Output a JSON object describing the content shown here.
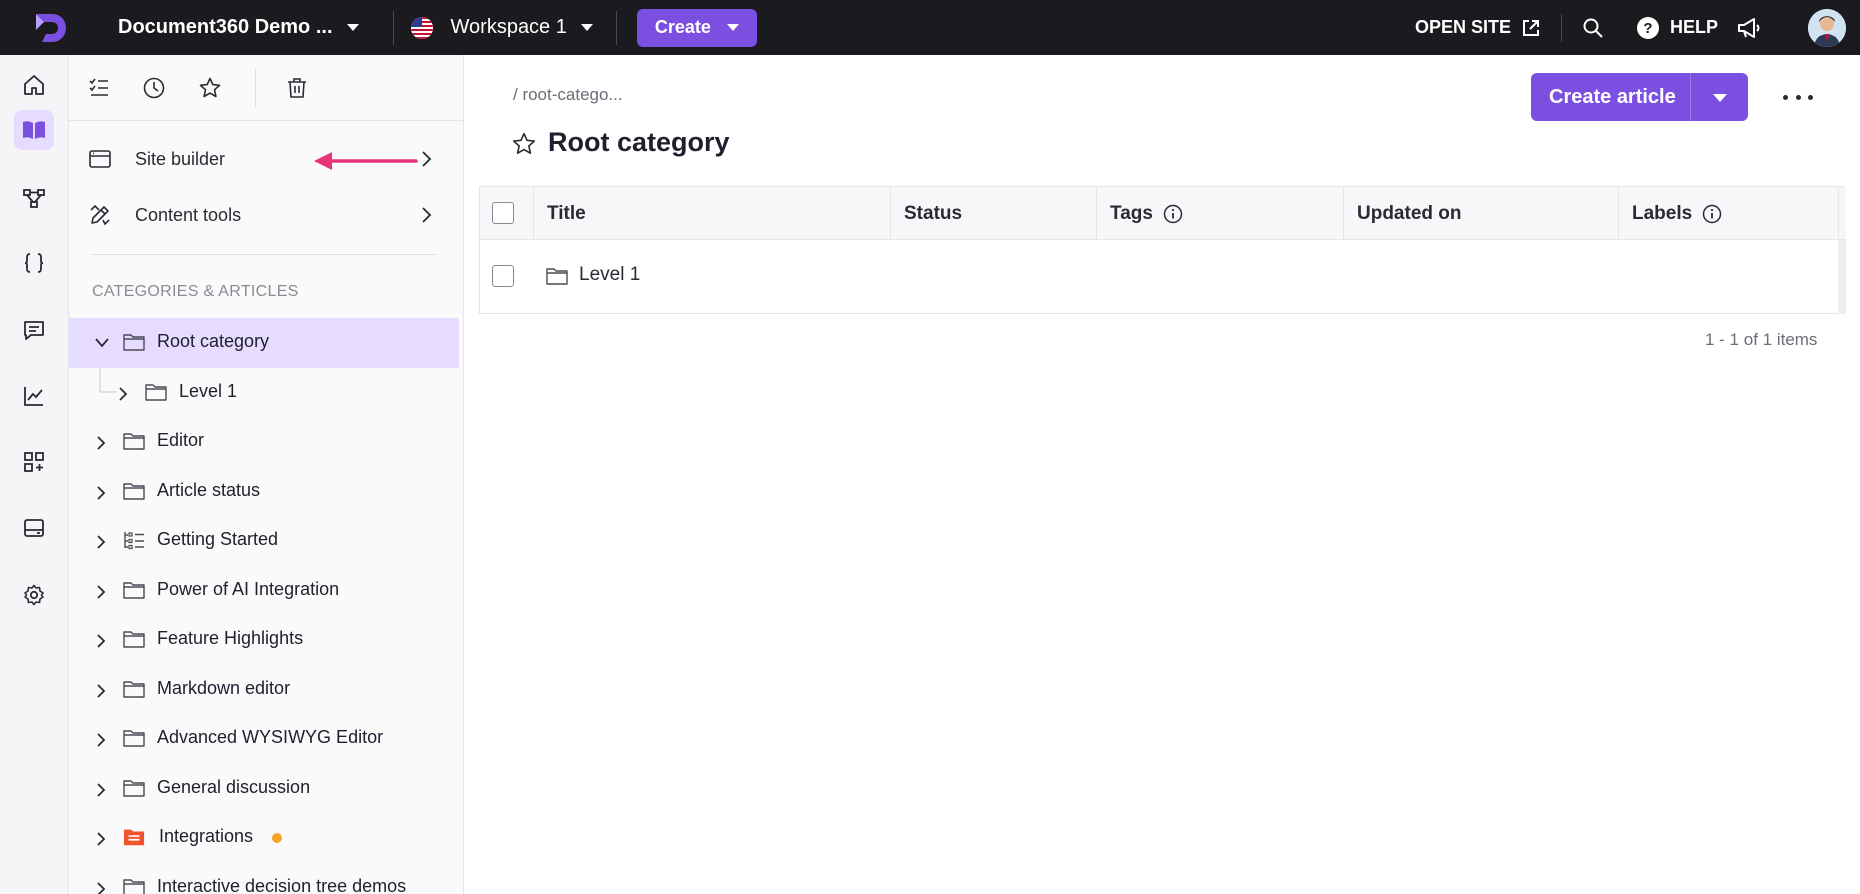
{
  "topbar": {
    "project_name": "Document360 Demo ...",
    "workspace": "Workspace 1",
    "create_label": "Create",
    "open_site_label": "OPEN SITE",
    "help_label": "HELP"
  },
  "rail": {
    "items": [
      "home-icon",
      "book-icon",
      "flow-icon",
      "code-braces-icon",
      "feedback-icon",
      "analytics-icon",
      "apps-add-icon",
      "drive-icon",
      "gear-icon"
    ],
    "active": "book-icon"
  },
  "sidebar": {
    "toolbar": [
      "checklist-icon",
      "clock-icon",
      "star-icon",
      "trash-icon"
    ],
    "menu": [
      {
        "label": "Site builder",
        "icon": "browser-window-icon"
      },
      {
        "label": "Content tools",
        "icon": "pencil-ruler-icon"
      }
    ],
    "section_title": "CATEGORIES & ARTICLES",
    "tree": [
      {
        "label": "Root category",
        "expanded": true,
        "selected": true
      },
      {
        "label": "Level 1"
      },
      {
        "label": "Editor"
      },
      {
        "label": "Article status"
      },
      {
        "label": "Getting Started"
      },
      {
        "label": "Power of AI Integration"
      },
      {
        "label": "Feature Highlights"
      },
      {
        "label": "Markdown editor"
      },
      {
        "label": "Advanced WYSIWYG Editor"
      },
      {
        "label": "General discussion"
      },
      {
        "label": "Integrations"
      },
      {
        "label": "Interactive decision tree demos"
      }
    ]
  },
  "main": {
    "breadcrumb": "/ root-catego...",
    "title": "Root category",
    "create_article_label": "Create article",
    "table": {
      "columns": [
        "Title",
        "Status",
        "Tags",
        "Updated on",
        "Labels"
      ],
      "rows": [
        {
          "title": "Level 1"
        }
      ]
    },
    "pagination": "1 - 1 of 1 items"
  },
  "colors": {
    "accent": "#7b4fe0",
    "topbar_bg": "#1b1b1f",
    "selected_bg": "#e6dcff",
    "annotation_arrow": "#e8357a",
    "integrations_icon": "#f0542c",
    "status_dot": "#f5a623"
  }
}
